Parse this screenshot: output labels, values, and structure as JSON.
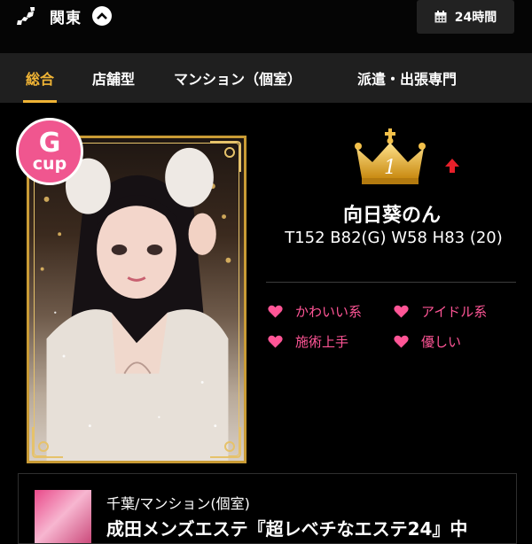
{
  "header": {
    "region_label": "関東",
    "hours_label": "24時間"
  },
  "tabs": [
    {
      "label": "総合"
    },
    {
      "label": "店舗型"
    },
    {
      "label": "マンション（個室）"
    },
    {
      "label": "派遣・出張専門"
    }
  ],
  "profile": {
    "cup_letter": "G",
    "cup_word": "cup",
    "rank": "1",
    "name": "向日葵のん",
    "stats": "T152 B82(G) W58 H83 (20)",
    "tags": [
      "かわいい系",
      "アイドル系",
      "施術上手",
      "優しい"
    ]
  },
  "shop": {
    "location": "千葉/マンション(個室)",
    "name": "成田メンズエステ『超レベチなエステ24』中"
  },
  "colors": {
    "accent_gold": "#f0b435",
    "pink": "#ff5596",
    "badge_pink": "#f0568f",
    "arrow_red": "#e8202a"
  }
}
